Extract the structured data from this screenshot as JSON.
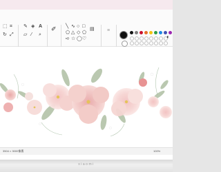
{
  "ribbon": {
    "groups": [
      "工具",
      "形状",
      "颜色"
    ],
    "tools_icons": [
      "pencil-icon",
      "fill-icon",
      "text-icon",
      "eraser-icon",
      "picker-icon",
      "magnifier-icon"
    ],
    "palette": [
      "#111111",
      "#7f7f7f",
      "#c8102e",
      "#e8702a",
      "#f2c511",
      "#2e9e48",
      "#1e88e5",
      "#3f51b5",
      "#9c27b0",
      "#ffffff",
      "#c3c3c3",
      "#e8a1a1"
    ]
  },
  "status": {
    "dimensions": "3504 × 3000像素",
    "zoom": "100%"
  },
  "bezel": {
    "brand": "xiaomi"
  }
}
